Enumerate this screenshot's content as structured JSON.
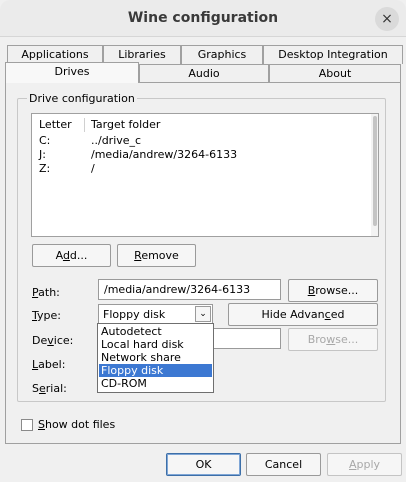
{
  "window": {
    "title": "Wine configuration",
    "close_glyph": "×"
  },
  "tabs_back": [
    "Applications",
    "Libraries",
    "Graphics",
    "Desktop Integration"
  ],
  "tabs_front": [
    "Drives",
    "Audio",
    "About"
  ],
  "active_tab": "Drives",
  "drive_config": {
    "group_title": "Drive configuration",
    "columns": [
      "Letter",
      "Target folder"
    ],
    "drives": [
      {
        "letter": "C:",
        "target": "../drive_c"
      },
      {
        "letter": "J:",
        "target": "/media/andrew/3264-6133"
      },
      {
        "letter": "Z:",
        "target": "/"
      }
    ]
  },
  "buttons": {
    "add": {
      "pre": "A",
      "mnemonic": "d",
      "post": "d..."
    },
    "remove": {
      "pre": "",
      "mnemonic": "R",
      "post": "emove"
    },
    "browse_path": {
      "pre": "",
      "mnemonic": "B",
      "post": "rowse..."
    },
    "browse_device": {
      "pre": "Bro",
      "mnemonic": "w",
      "post": "se..."
    },
    "hide_advanced": {
      "pre": "Hide Advan",
      "mnemonic": "c",
      "post": "ed"
    }
  },
  "fields": {
    "path": {
      "pre": "",
      "mnemonic": "P",
      "post": "ath:",
      "value": "/media/andrew/3264-6133"
    },
    "type": {
      "pre": "",
      "mnemonic": "T",
      "post": "ype:",
      "value": "Floppy disk"
    },
    "device": {
      "pre": "De",
      "mnemonic": "v",
      "post": "ice:"
    },
    "label": {
      "pre": "",
      "mnemonic": "L",
      "post": "abel:"
    },
    "serial": {
      "pre": "S",
      "mnemonic": "e",
      "post": "rial:"
    }
  },
  "type_options": [
    "Autodetect",
    "Local hard disk",
    "Network share",
    "Floppy disk",
    "CD-ROM"
  ],
  "show_dot_files": {
    "pre": "",
    "mnemonic": "S",
    "post": "how dot files",
    "checked": false
  },
  "dialog_buttons": {
    "ok": "OK",
    "cancel": "Cancel",
    "apply": {
      "pre": "",
      "mnemonic": "A",
      "post": "pply"
    }
  },
  "colors": {
    "selection": "#3c78d2",
    "window_bg": "#f0f0f0"
  }
}
